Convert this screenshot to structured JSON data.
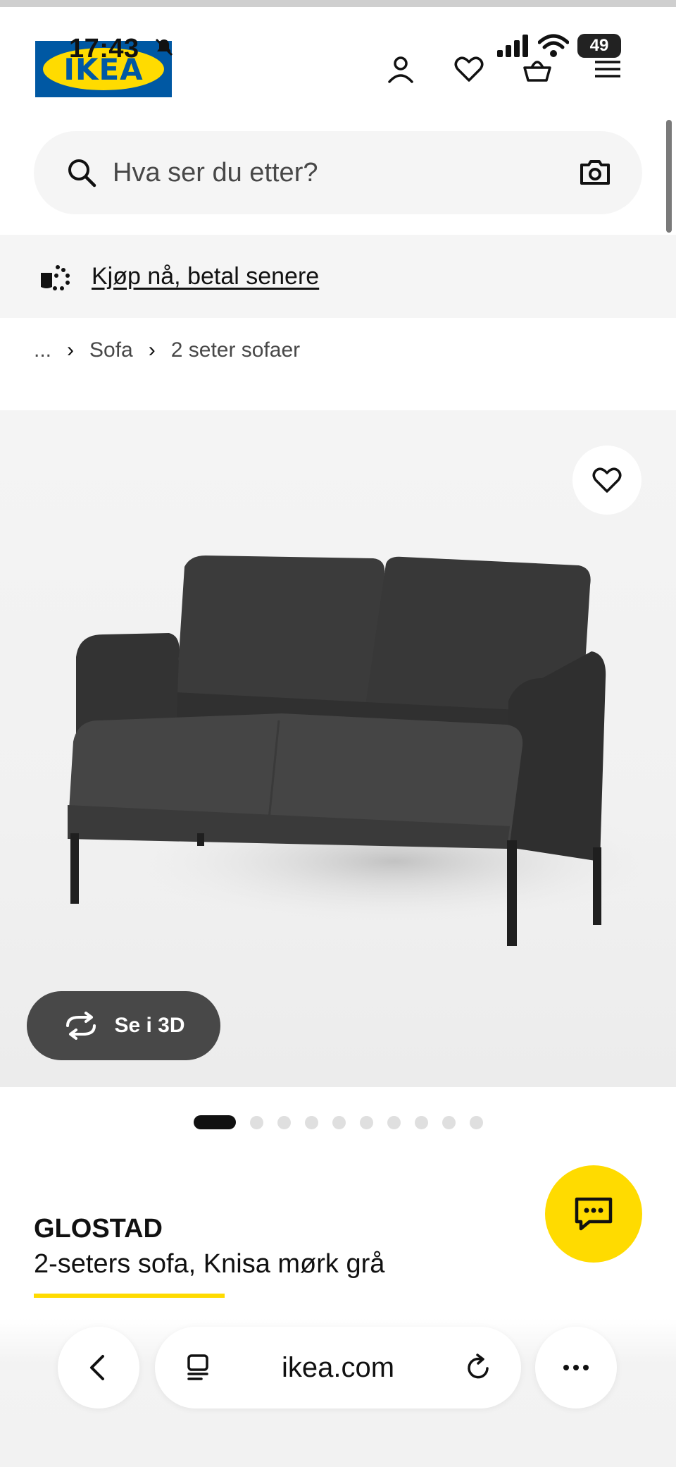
{
  "status_bar": {
    "time": "17:43",
    "battery": "49"
  },
  "header": {
    "logo_text": "IKEA",
    "icons": [
      "user-icon",
      "heart-icon",
      "basket-icon",
      "menu-icon"
    ]
  },
  "search": {
    "placeholder": "Hva ser du etter?"
  },
  "promo": {
    "label": "Kjøp nå, betal senere"
  },
  "breadcrumb": {
    "ellipsis": "...",
    "items": [
      "Sofa",
      "2 seter sofaer"
    ]
  },
  "gallery": {
    "view_3d_label": "Se i 3D",
    "image_count": 10,
    "active_index": 0
  },
  "product": {
    "name": "GLOSTAD",
    "description": "2-seters sofa, Knisa mørk grå"
  },
  "browser": {
    "url": "ikea.com"
  },
  "colors": {
    "brand_blue": "#0058a3",
    "brand_yellow": "#ffdb00",
    "sofa": "#3a3a3a"
  }
}
